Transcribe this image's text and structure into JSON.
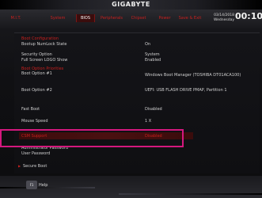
{
  "brand": "GIGABYTE",
  "tabs": [
    {
      "label": "M.I.T."
    },
    {
      "label": "System"
    },
    {
      "label": "BIOS"
    },
    {
      "label": "Peripherals"
    },
    {
      "label": "Chipset"
    },
    {
      "label": "Power"
    },
    {
      "label": "Save & Exit"
    }
  ],
  "active_tab": "BIOS",
  "clock": {
    "date": "03/14/2018",
    "day": "Wednesday",
    "time": "00:10"
  },
  "sections": {
    "boot_configuration": "Boot Configuration",
    "boot_option_priorities": "Boot Option Priorities"
  },
  "settings": [
    {
      "label": "Bootup NumLock State",
      "value": "On"
    },
    {
      "label": "Security Option",
      "value": "System"
    },
    {
      "label": "Full Screen LOGO Show",
      "value": "Enabled"
    },
    {
      "label": "Boot Option #1",
      "value": "Windows Boot Manager (TOSHIBA DT01ACA100)"
    },
    {
      "label": "Boot Option #2",
      "value": "UEFI: USB FLASH DRIVE PMAP, Partition 1"
    },
    {
      "label": "Fast Boot",
      "value": "Disabled"
    },
    {
      "label": "Mouse Speed",
      "value": "1 X"
    },
    {
      "label": "CSM Support",
      "value": "Disabled"
    },
    {
      "label": "Administrator Password",
      "value": ""
    },
    {
      "label": "User Password",
      "value": ""
    },
    {
      "label": "Secure Boot",
      "value": ""
    }
  ],
  "footer": {
    "help_key": "F1",
    "help_label": "Help"
  },
  "colors": {
    "accent": "#c8201e",
    "callout": "#d4187e",
    "highlight": "#4a1010"
  }
}
